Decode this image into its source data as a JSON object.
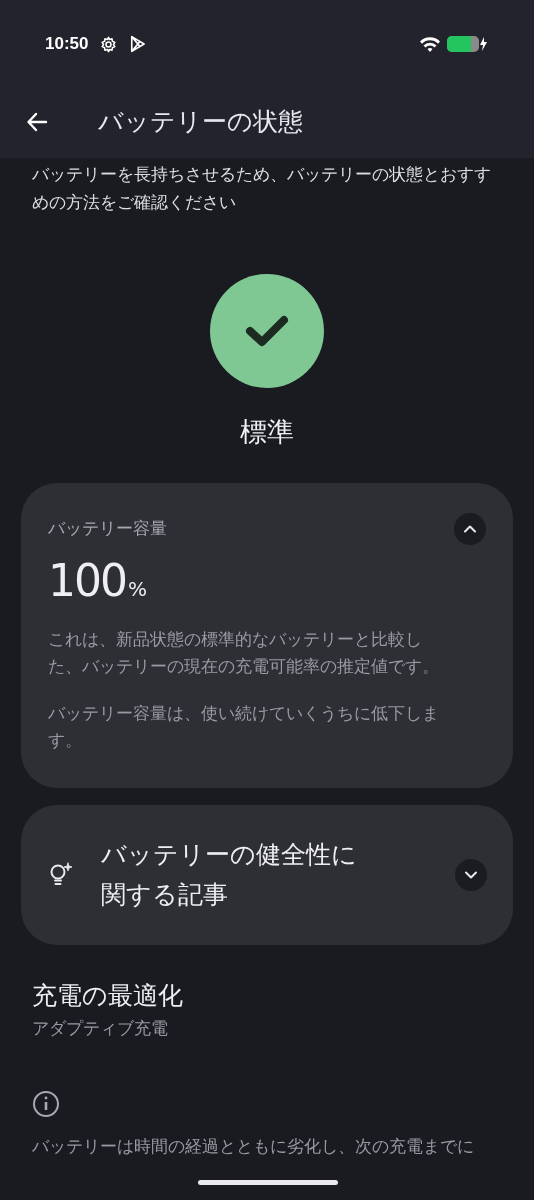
{
  "status_bar": {
    "time": "10:50"
  },
  "app_bar": {
    "title": "バッテリーの状態"
  },
  "intro": "バッテリーを長持ちさせるため、バッテリーの状態とおすすめの方法をご確認ください",
  "status": {
    "label": "標準"
  },
  "cards": [
    {
      "kind": "capacity",
      "title": "バッテリー容量",
      "expanded": true,
      "value": "100",
      "unit": "%",
      "paragraphs": [
        "これは、新品状態の標準的なバッテリーと比較した、バッテリーの現在の充電可能率の推定値です。",
        "バッテリー容量は、使い続けていくうちに低下します。"
      ]
    },
    {
      "kind": "article",
      "title": "バッテリーの健全性に関する記事",
      "expanded": false
    }
  ],
  "charging": {
    "title": "充電の最適化",
    "subtitle": "アダプティブ充電",
    "note": "バッテリーは時間の経過とともに劣化し、次の充電までに"
  }
}
